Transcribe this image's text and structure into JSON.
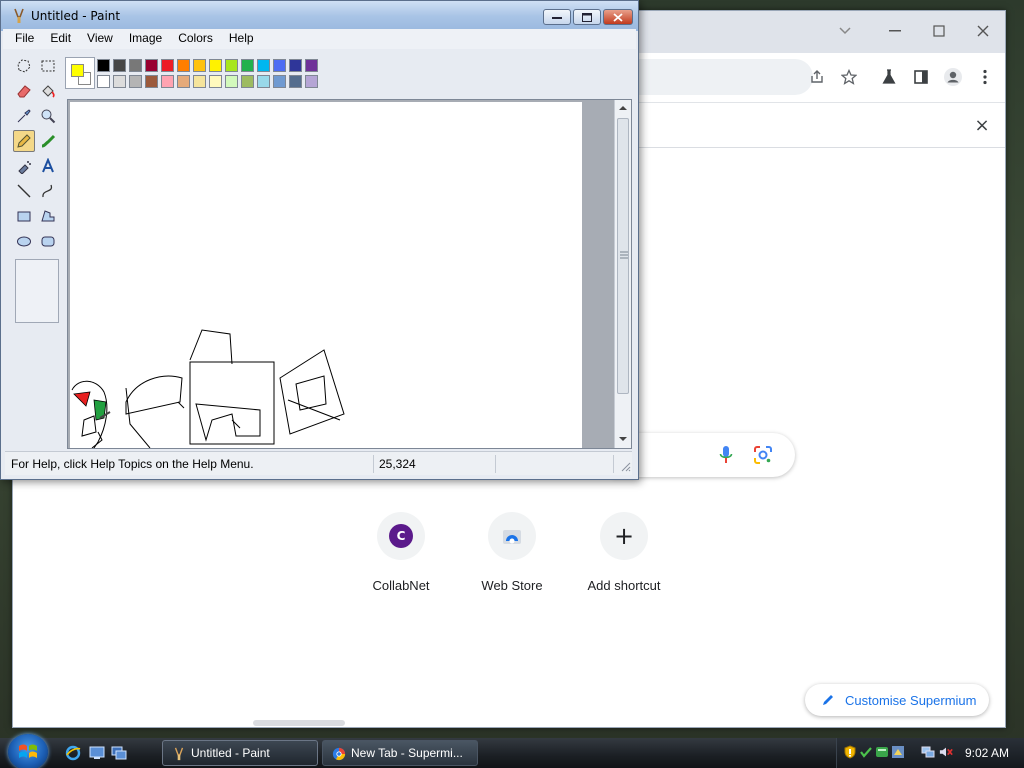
{
  "paint": {
    "title": "Untitled - Paint",
    "menu": [
      "File",
      "Edit",
      "View",
      "Image",
      "Colors",
      "Help"
    ],
    "status_help": "For Help, click Help Topics on the Help Menu.",
    "status_coords": "25,324",
    "foreground_color": "#ffff00",
    "background_color": "#ffffff",
    "palette_top": [
      "#000000",
      "#464646",
      "#787878",
      "#990030",
      "#ed1c24",
      "#ff7e00",
      "#ffc20e",
      "#fff200",
      "#a8e61d",
      "#22b14c",
      "#00b7ef",
      "#4d6df3",
      "#2f3699",
      "#6f3198"
    ],
    "palette_bottom": [
      "#ffffff",
      "#dcdcdc",
      "#b4b4b4",
      "#9c5a3c",
      "#ffa3b1",
      "#e5aa7a",
      "#f5e49c",
      "#fff9bd",
      "#d3f9bc",
      "#9dbb61",
      "#99d9ea",
      "#709ad1",
      "#546d8e",
      "#b5a5d5"
    ]
  },
  "browser": {
    "shortcuts": [
      {
        "label": "CollabNet",
        "icon": "collabnet-icon",
        "letter": "C"
      },
      {
        "label": "Web Store",
        "icon": "web-store-icon"
      },
      {
        "label": "Add shortcut",
        "icon": "plus-icon",
        "glyph": "+"
      }
    ],
    "customise_label": "Customise Supermium",
    "close_glyph": "×"
  },
  "taskbar": {
    "tasks": [
      {
        "label": "Untitled - Paint",
        "icon": "paint-icon"
      },
      {
        "label": "New Tab - Supermi...",
        "icon": "supermium-icon"
      }
    ],
    "clock": "9:02 AM"
  }
}
